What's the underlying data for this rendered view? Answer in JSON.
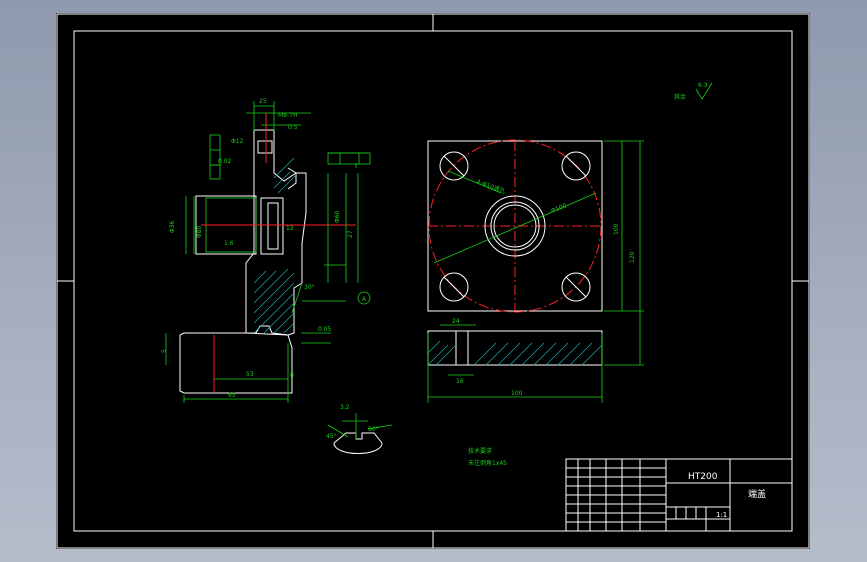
{
  "drawing": {
    "notes": {
      "roughness_value": "6.3",
      "roughness_label": "其余",
      "tech_req_title": "技术要求",
      "tech_req_text": "未注倒角1x45"
    },
    "dims_left": {
      "top_width": "25",
      "thread": "M8-7H",
      "depth": "0.5",
      "dia_a": "Φ12",
      "dia_b": "Φ36",
      "dia_c": "Φ80",
      "dia_d": "Φ60",
      "height_a": "27",
      "height_b": "12",
      "flat_h": "5",
      "base_a": "53",
      "base_b": "65",
      "base_c": "8",
      "tol_a": "0.05",
      "tol_b": "0.02",
      "chamfer": "1.6",
      "angle_a": "30°",
      "angle_b": "45°",
      "angle_c": "60°",
      "datum": "A",
      "rough_small": "3.2"
    },
    "dims_right": {
      "hole_dia": "4-Φ10通孔",
      "pcd": "Φ100",
      "height": "120",
      "height_b": "100",
      "width": "100",
      "slot": "24",
      "slot_b": "16"
    },
    "colors": {
      "dimension": "#18d018",
      "centerline": "#ff2020",
      "outline": "#ffffff",
      "hatch": "#1fa8a8"
    }
  },
  "title_block": {
    "part_name": "端盖",
    "material": "HT200",
    "scale": "1:1"
  }
}
